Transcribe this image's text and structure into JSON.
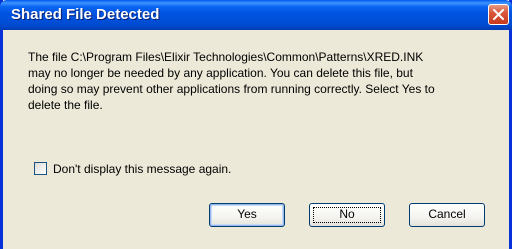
{
  "dialog": {
    "title": "Shared File Detected",
    "message_lines": [
      "The file C:\\Program Files\\Elixir Technologies\\Common\\Patterns\\XRED.INK",
      "may no longer be needed by any application. You can delete this file, but",
      "doing so may prevent other applications from running correctly.  Select Yes to",
      "delete the file."
    ],
    "checkbox": {
      "label": "Don't display this message again.",
      "checked": false
    },
    "buttons": {
      "yes": "Yes",
      "no": "No",
      "cancel": "Cancel"
    }
  },
  "icons": {
    "close": "close-icon"
  },
  "colors": {
    "titlebar": "#0054e3",
    "window_bg": "#ece9d8",
    "close_button": "#d9583c",
    "border": "#0831d9"
  }
}
